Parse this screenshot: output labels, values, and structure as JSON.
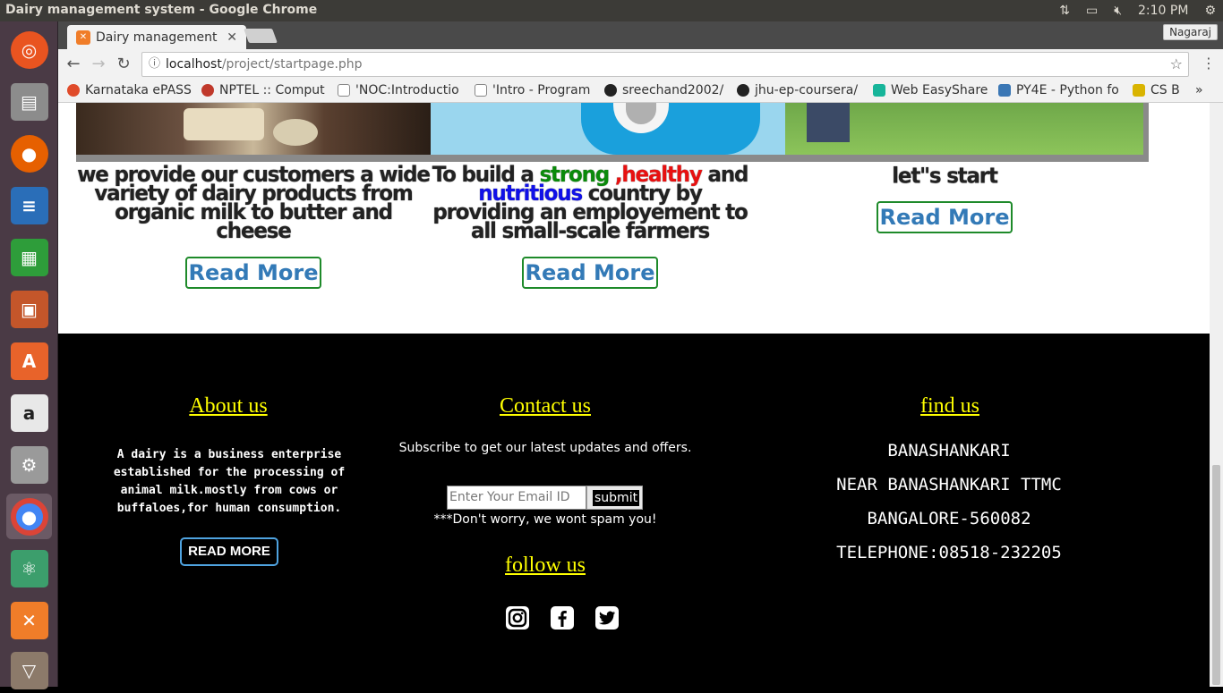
{
  "os": {
    "window_title": "Dairy management system - Google Chrome",
    "time": "2:10 PM"
  },
  "chrome": {
    "tab_title": "Dairy management",
    "user": "Nagaraj",
    "url_host": "localhost",
    "url_path": "/project/startpage.php",
    "bookmarks": [
      {
        "label": "Karnataka ePASS",
        "color": "#e04b2a"
      },
      {
        "label": "NPTEL :: Comput",
        "color": "#c0392b"
      },
      {
        "label": "'NOC:Introductio",
        "color": "#888888"
      },
      {
        "label": "'Intro - Program",
        "color": "#888888"
      },
      {
        "label": "sreechand2002/",
        "color": "#222222"
      },
      {
        "label": "jhu-ep-coursera/",
        "color": "#222222"
      },
      {
        "label": "Web EasyShare",
        "color": "#17b59a"
      },
      {
        "label": "PY4E - Python fo",
        "color": "#3b77b5"
      },
      {
        "label": "CS B",
        "color": "#d9b400"
      }
    ],
    "bookmarks_overflow": "»"
  },
  "cards": {
    "card1_text": "we provide our customers a wide variety of dairy products from organic milk to butter and cheese",
    "card2_pre": "To build a ",
    "card2_strong": "strong",
    "card2_healthy": " ,healthy",
    "card2_and": " and ",
    "card2_nutritious": "nutritious",
    "card2_post": " country by providing an employement to all small-scale farmers",
    "card3_text": "let\"s start",
    "read_more": "Read More"
  },
  "footer": {
    "about_title": "About us",
    "about_text": "A dairy is a business enterprise established for the processing of animal milk.mostly from cows or buffaloes,for human consumption.",
    "about_button": "READ MORE",
    "contact_title": "Contact us",
    "subscribe_text": "Subscribe to get our latest updates and offers.",
    "email_placeholder": "Enter Your Email ID",
    "submit_label": "submit",
    "spam_note": "***Don't worry, we wont spam you!",
    "follow_title": "follow us",
    "find_title": "find us",
    "address_line1": "BANASHANKARI",
    "address_line2": "NEAR BANASHANKARI TTMC",
    "address_line3": "BANGALORE-560082",
    "telephone": "TELEPHONE:08518-232205"
  },
  "icons": [
    "instagram-icon",
    "facebook-icon",
    "twitter-icon"
  ]
}
